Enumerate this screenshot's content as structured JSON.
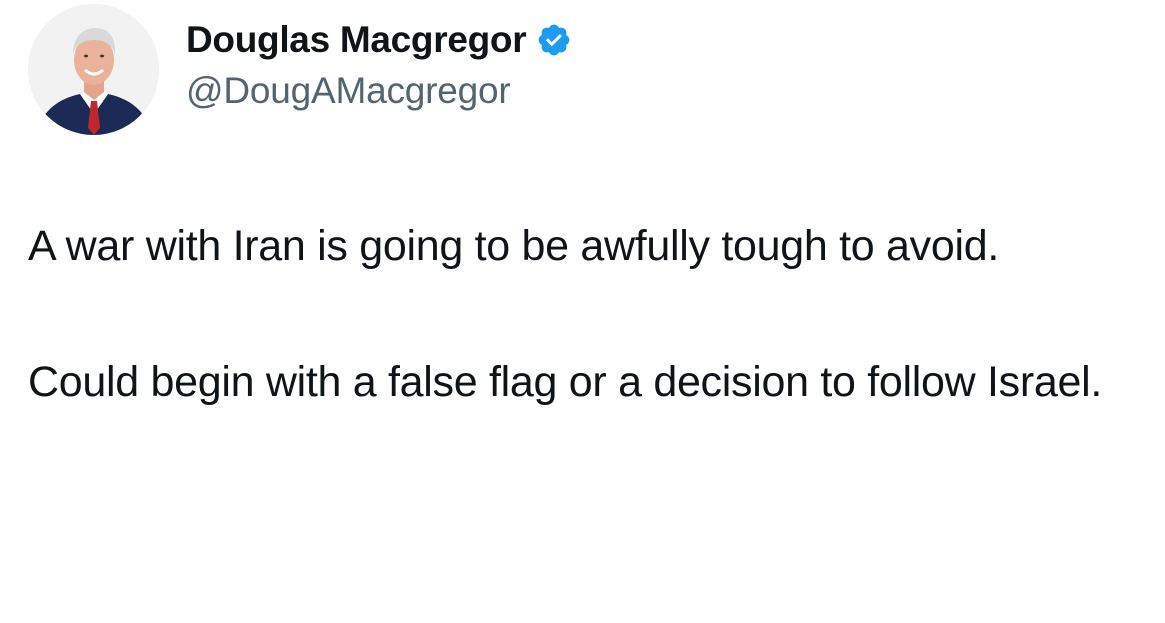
{
  "author": {
    "display_name": "Douglas Macgregor",
    "handle": "@DougAMacgregor",
    "verified": true,
    "avatar_icon": "avatar-photo",
    "verified_icon": "verified-badge-icon"
  },
  "tweet": {
    "paragraphs": [
      "A war with Iran is going to be awfully tough to avoid.",
      "Could begin with a false flag or a decision to follow Israel."
    ]
  },
  "colors": {
    "text_primary": "#0f1419",
    "text_secondary": "#536471",
    "verified_blue": "#1d9bf0",
    "background": "#ffffff"
  }
}
